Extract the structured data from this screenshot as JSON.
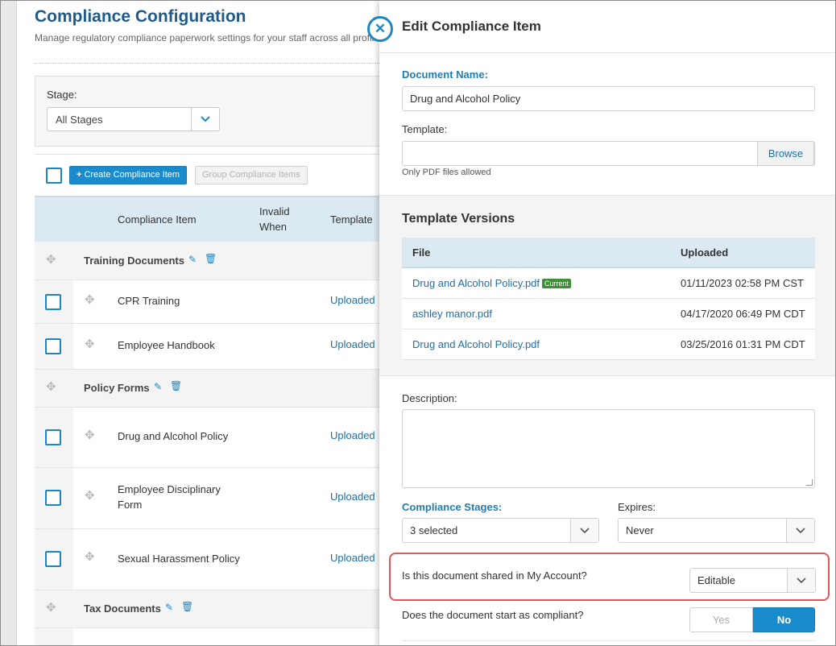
{
  "page": {
    "title": "Compliance Configuration",
    "subtitle": "Manage regulatory compliance paperwork settings for your staff across all profile.",
    "stage_label": "Stage:",
    "stage_value": "All Stages",
    "create_button": "Create Compliance Item",
    "group_button": "Group Compliance Items",
    "columns": {
      "item": "Compliance Item",
      "invalid_when": "Invalid When",
      "template": "Template"
    },
    "groups": [
      {
        "name": "Training Documents"
      },
      {
        "name": "Policy Forms"
      },
      {
        "name": "Tax Documents"
      }
    ],
    "rows": [
      {
        "name": "CPR Training",
        "status": "Uploaded"
      },
      {
        "name": "Employee Handbook",
        "status": "Uploaded"
      },
      {
        "name": "Drug and Alcohol Policy",
        "status": "Uploaded"
      },
      {
        "name": "Employee Disciplinary Form",
        "status": "Uploaded"
      },
      {
        "name": "Sexual Harassment Policy",
        "status": "Uploaded"
      }
    ]
  },
  "panel": {
    "title": "Edit Compliance Item",
    "document_name_label": "Document Name:",
    "document_name_value": "Drug and Alcohol Policy",
    "template_label": "Template:",
    "template_value": "",
    "browse_button": "Browse",
    "pdf_hint": "Only PDF files allowed",
    "versions_title": "Template Versions",
    "versions_columns": {
      "file": "File",
      "uploaded": "Uploaded"
    },
    "versions": [
      {
        "file": "Drug and Alcohol Policy.pdf",
        "uploaded": "01/11/2023 02:58 PM CST",
        "badge": "Current"
      },
      {
        "file": "ashley manor.pdf",
        "uploaded": "04/17/2020 06:49 PM CDT"
      },
      {
        "file": "Drug and Alcohol Policy.pdf",
        "uploaded": "03/25/2016 01:31 PM CDT"
      }
    ],
    "description_label": "Description:",
    "description_value": "",
    "stages_label": "Compliance Stages:",
    "stages_value": "3 selected",
    "expires_label": "Expires:",
    "expires_value": "Never",
    "shared_question": "Is this document shared in My Account?",
    "shared_value": "Editable",
    "compliant_question": "Does the document start as compliant?",
    "compliant_yes": "Yes",
    "compliant_no": "No",
    "compliant_selected": "No"
  },
  "colors": {
    "brand_blue": "#1f86c4",
    "title_blue": "#1e5a8a",
    "highlight_red": "#e0585a",
    "badge_green": "#3f8f3a"
  },
  "icons": {
    "close": "close-circle-icon",
    "caret": "chevron-down-icon",
    "drag": "move-icon",
    "edit": "pencil-icon",
    "delete": "trash-icon",
    "add": "plus-icon"
  }
}
